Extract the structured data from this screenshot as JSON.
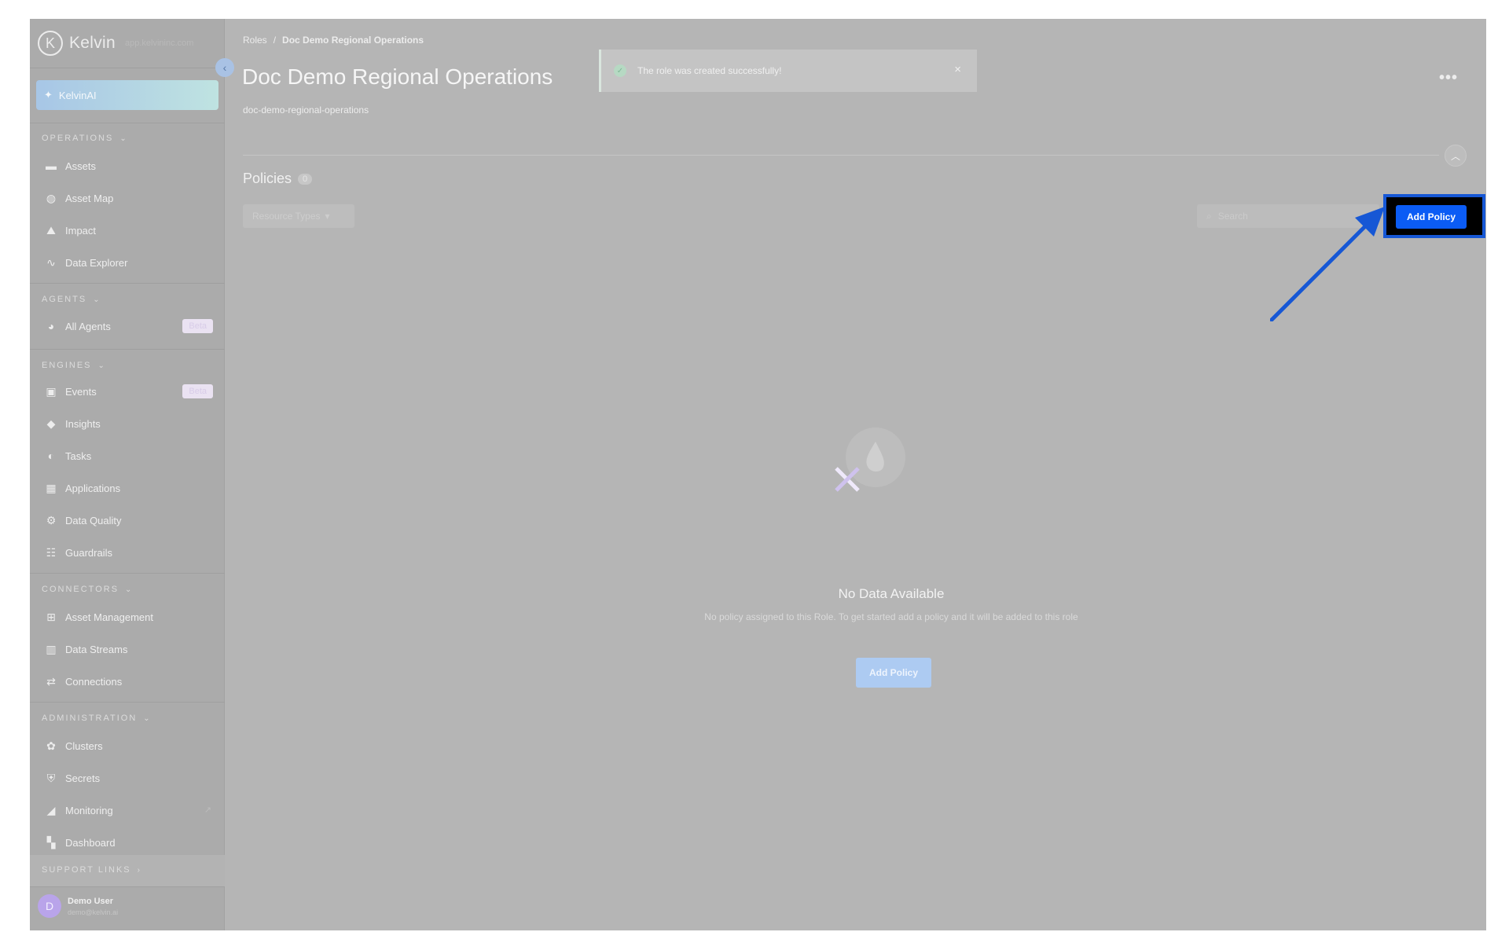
{
  "app": {
    "name": "Kelvin",
    "logo_letter": "K",
    "subtitle": "app.kelvininc.com"
  },
  "sidebar": {
    "ai_button": "KelvinAI",
    "sections": {
      "operations": "OPERATIONS",
      "agents": "AGENTS",
      "engines": "ENGINES",
      "connectors": "CONNECTORS",
      "administration": "ADMINISTRATION",
      "support": "SUPPORT LINKS"
    },
    "items": {
      "assets": "Assets",
      "asset_map": "Asset Map",
      "impact": "Impact",
      "data_explorer": "Data Explorer",
      "all_agents": "All Agents",
      "events": "Events",
      "insights": "Insights",
      "tasks": "Tasks",
      "applications": "Applications",
      "data_quality": "Data Quality",
      "guardrails": "Guardrails",
      "asset_management": "Asset Management",
      "data_streams": "Data Streams",
      "connections": "Connections",
      "clusters": "Clusters",
      "secrets": "Secrets",
      "monitoring": "Monitoring",
      "dashboard": "Dashboard"
    },
    "beta_label": "Beta",
    "user": {
      "initial": "D",
      "name": "Demo User",
      "email": "demo@kelvin.ai"
    }
  },
  "breadcrumb": {
    "parent": "Roles",
    "separator": "/",
    "current": "Doc Demo Regional Operations"
  },
  "page": {
    "title": "Doc Demo Regional Operations",
    "slug": "doc-demo-regional-operations",
    "more": "•••"
  },
  "toast": {
    "message": "The role was created successfully!",
    "close": "×"
  },
  "policies": {
    "heading": "Policies",
    "count": "0",
    "filter_label": "Resource Types",
    "search_placeholder": "Search",
    "add_button": "Add Policy"
  },
  "empty_state": {
    "title": "No Data Available",
    "description": "No policy assigned to this Role. To get started add a policy and it will be added to this role",
    "button": "Add Policy"
  },
  "colors": {
    "accent": "#0b5cf5",
    "highlight": "#1657d5"
  }
}
